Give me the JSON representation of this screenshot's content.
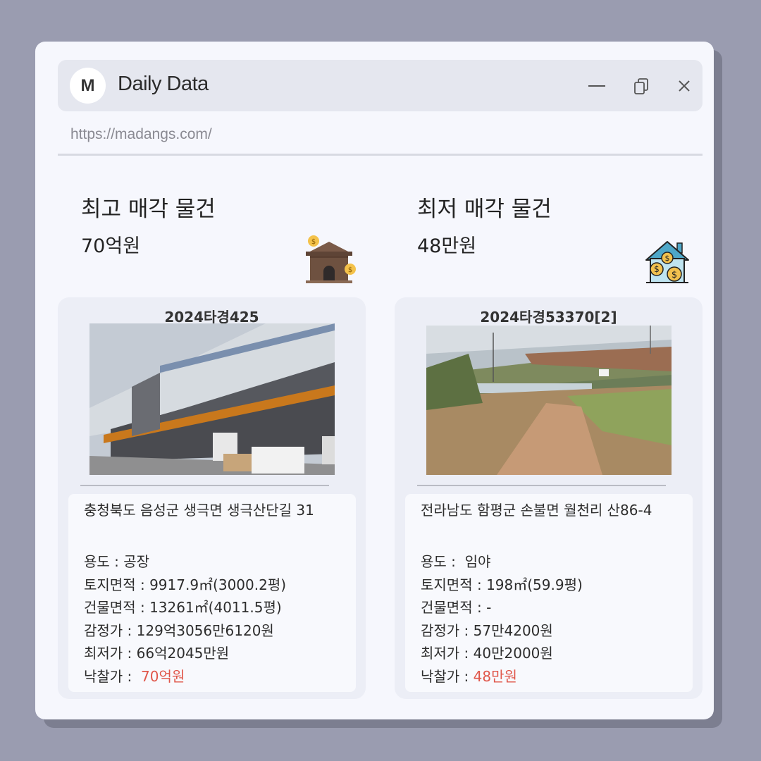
{
  "window": {
    "logo_letter": "M",
    "title": "Daily Data",
    "url": "https://madangs.com/"
  },
  "highest": {
    "heading": "최고 매각 물건",
    "amount": "70억원",
    "icon": "warehouse-money-icon",
    "case_no": "2024타경425",
    "address": "충청북도 음성군 생극면 생극산단길 31",
    "rows": {
      "use_label": "용도 : ",
      "use_value": "공장",
      "land_label": "토지면적 : ",
      "land_value": "9917.9㎡(3000.2평)",
      "building_label": "건물면적 : ",
      "building_value": "13261㎡(4011.5평)",
      "appraisal_label": "감정가 : ",
      "appraisal_value": "129억3056만6120원",
      "minimum_label": "최저가 : ",
      "minimum_value": "66억2045만원",
      "winning_label": "낙찰가 :  ",
      "winning_value": "70억원"
    }
  },
  "lowest": {
    "heading": "최저 매각 물건",
    "amount": "48만원",
    "icon": "house-coins-icon",
    "case_no": "2024타경53370[2]",
    "address": "전라남도 함평군 손불면 월천리 산86-4",
    "rows": {
      "use_label": "용도 :  ",
      "use_value": "임야",
      "land_label": "토지면적 : ",
      "land_value": "198㎡(59.9평)",
      "building_label": "건물면적 : ",
      "building_value": "-",
      "appraisal_label": "감정가 : ",
      "appraisal_value": "57만4200원",
      "minimum_label": "최저가 : ",
      "minimum_value": "40만2000원",
      "winning_label": "낙찰가 : ",
      "winning_value": "48만원"
    }
  },
  "colors": {
    "background": "#9a9cb0",
    "window": "#f6f7fd",
    "titlebar": "#e5e7ef",
    "highlight_price": "#e0564a"
  }
}
